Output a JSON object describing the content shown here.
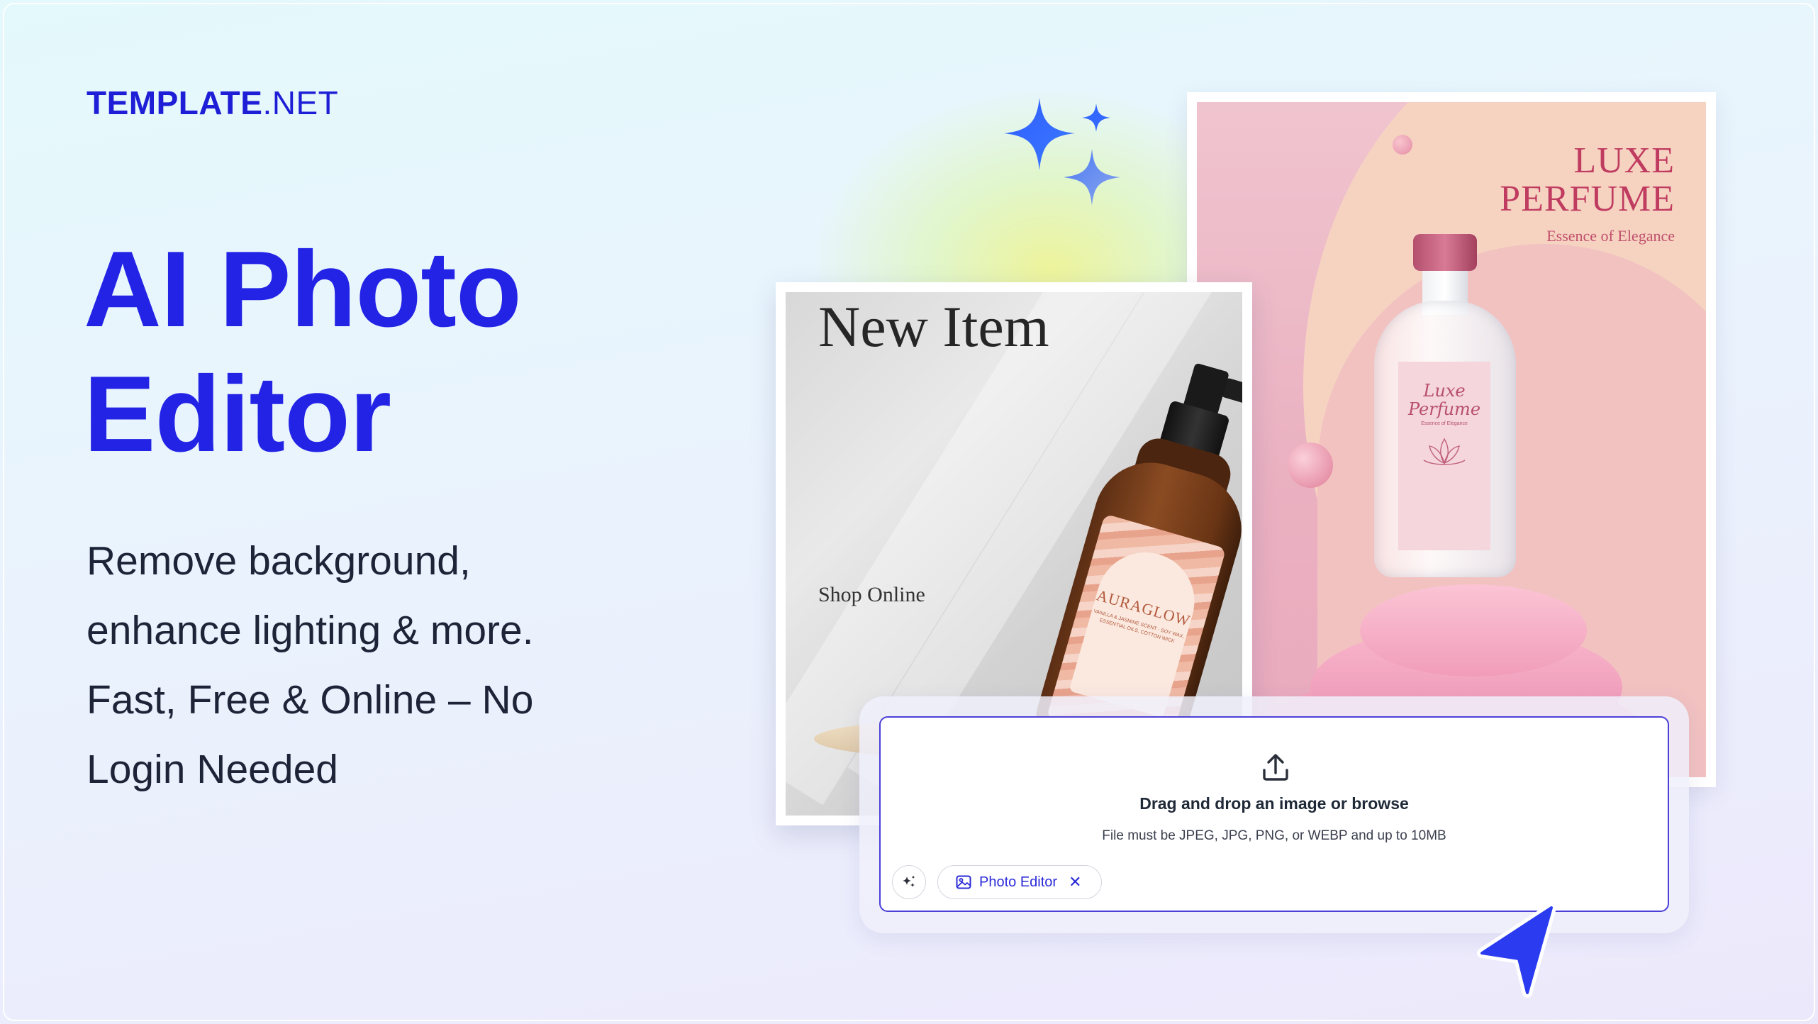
{
  "brand": {
    "bold": "TEMPLATE",
    "light": ".NET"
  },
  "hero": {
    "title_line1": "AI Photo",
    "title_line2": "Editor",
    "sub_line1": "Remove background,",
    "sub_line2": "enhance lighting & more.",
    "sub_line3": "Fast, Free & Online – No",
    "sub_line4": "Login Needed"
  },
  "new_item_card": {
    "title": "New Item",
    "cta": "Shop Online",
    "product_label": "AURAGLOW",
    "product_sub": "VANILLA & JASMINE SCENT · SOY WAX, ESSENTIAL OILS, COTTON WICK"
  },
  "perfume_card": {
    "title_line1": "LUXE",
    "title_line2": "PERFUME",
    "subtitle": "Essence of Elegance",
    "bottle_label_line1": "Luxe",
    "bottle_label_line2": "Perfume",
    "bottle_label_sub": "Essence of Elegance"
  },
  "upload": {
    "title": "Drag and drop an image or browse",
    "hint": "File must be JPEG, JPG, PNG, or WEBP and up to 10MB",
    "chip_label": "Photo Editor",
    "chip_close": "✕"
  },
  "colors": {
    "brand_blue": "#2323e6",
    "upload_border": "#4b3fd8",
    "cursor_blue": "#2b3bf0"
  },
  "icons": [
    "upload-icon",
    "sparkle-wand-icon",
    "image-icon",
    "close-icon",
    "cursor-pointer-icon",
    "sparkles-icon"
  ]
}
